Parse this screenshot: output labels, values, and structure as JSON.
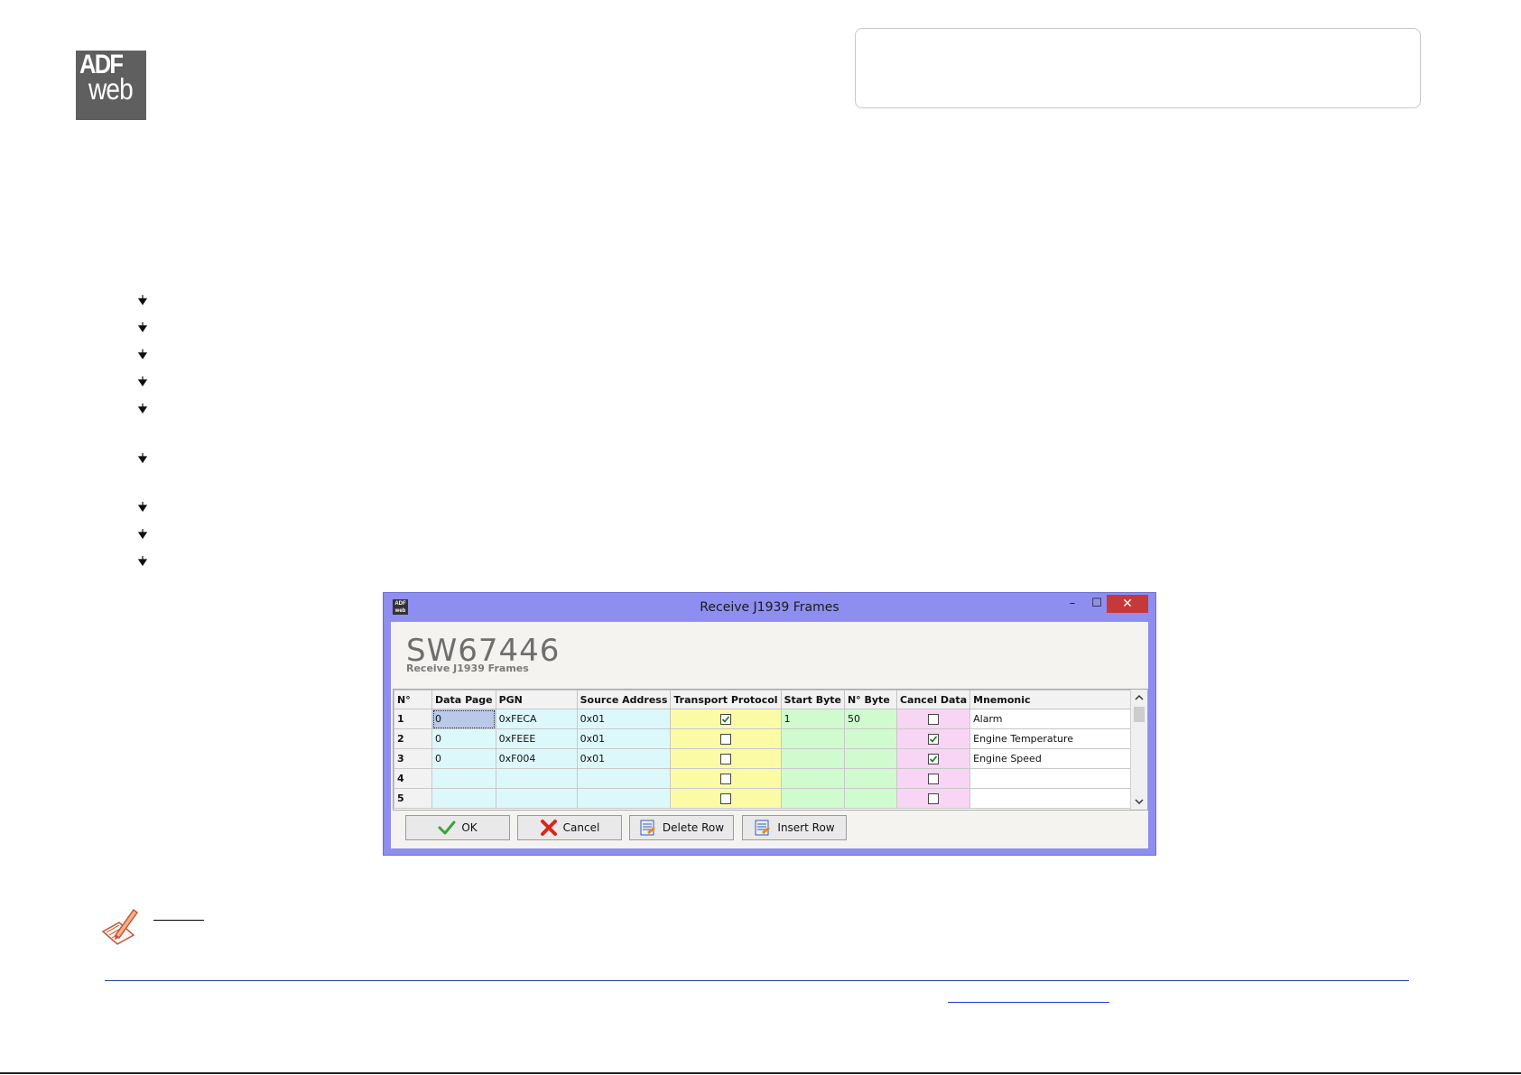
{
  "logo": {
    "top": "ADF",
    "bottom": "web"
  },
  "dialog": {
    "title": "Receive J1939 Frames",
    "window_buttons": {
      "minimize": "–",
      "maximize": "☐",
      "close": "✕"
    },
    "product_code": "SW67446",
    "product_subtitle": "Receive J1939 Frames",
    "table": {
      "headers": [
        "N°",
        "Data Page",
        "PGN",
        "Source Address",
        "Transport Protocol",
        "Start Byte",
        "N° Byte",
        "Cancel Data",
        "Mnemonic"
      ],
      "rows": [
        {
          "n": "1",
          "data_page": "0",
          "pgn": "0xFECA",
          "source_address": "0x01",
          "transport_protocol": true,
          "start_byte": "1",
          "n_byte": "50",
          "cancel_data": false,
          "mnemonic": "Alarm"
        },
        {
          "n": "2",
          "data_page": "0",
          "pgn": "0xFEEE",
          "source_address": "0x01",
          "transport_protocol": false,
          "start_byte": "",
          "n_byte": "",
          "cancel_data": true,
          "mnemonic": "Engine Temperature"
        },
        {
          "n": "3",
          "data_page": "0",
          "pgn": "0xF004",
          "source_address": "0x01",
          "transport_protocol": false,
          "start_byte": "",
          "n_byte": "",
          "cancel_data": true,
          "mnemonic": "Engine Speed"
        },
        {
          "n": "4",
          "data_page": "",
          "pgn": "",
          "source_address": "",
          "transport_protocol": false,
          "start_byte": "",
          "n_byte": "",
          "cancel_data": false,
          "mnemonic": ""
        },
        {
          "n": "5",
          "data_page": "",
          "pgn": "",
          "source_address": "",
          "transport_protocol": false,
          "start_byte": "",
          "n_byte": "",
          "cancel_data": false,
          "mnemonic": ""
        }
      ]
    },
    "buttons": {
      "ok": "OK",
      "cancel": "Cancel",
      "delete_row": "Delete Row",
      "insert_row": "Insert Row"
    },
    "colors": {
      "titlebar": "#8e8ef0",
      "close": "#c7383a",
      "cyan": "#ddf8fb",
      "yellow": "#fbfba6",
      "green": "#cffbcf",
      "pink": "#f9d5f5"
    }
  },
  "icons": {
    "bullets": "arrow-bullet-icon",
    "note": "note-pencil-icon",
    "ok": "checkmark-icon",
    "cancel": "red-x-icon",
    "delete_row": "delete-row-icon",
    "insert_row": "insert-row-icon"
  }
}
